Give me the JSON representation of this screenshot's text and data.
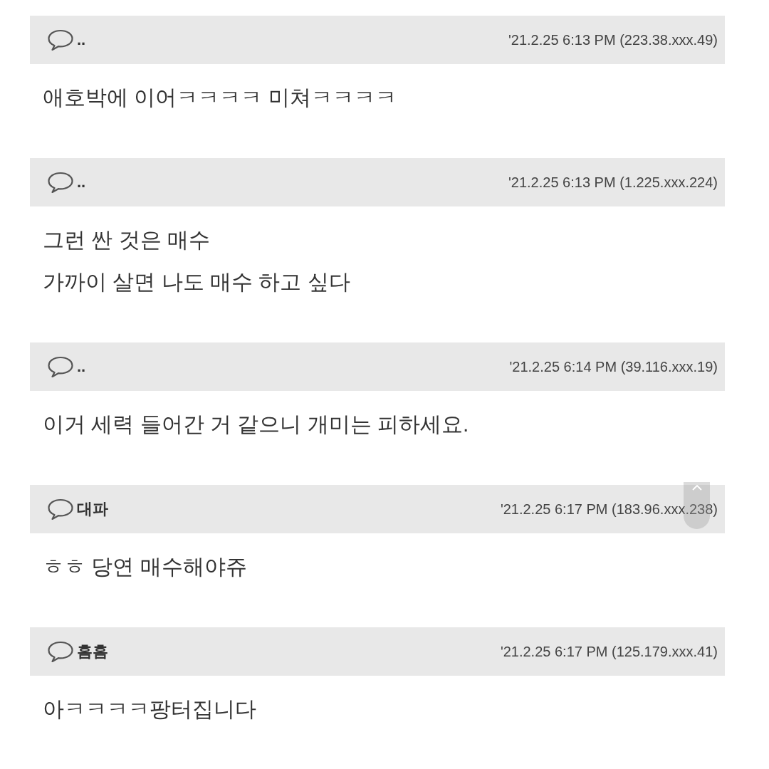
{
  "comments": [
    {
      "author": "..",
      "date": "'21.2.25 6:13 PM (223.38.xxx.49)",
      "lines": [
        "애호박에 이어ㅋㅋㅋㅋ 미쳐ㅋㅋㅋㅋ"
      ]
    },
    {
      "author": "..",
      "date": "'21.2.25 6:13 PM (1.225.xxx.224)",
      "lines": [
        "그런 싼 것은 매수",
        "가까이 살면 나도 매수 하고 싶다"
      ]
    },
    {
      "author": "..",
      "date": "'21.2.25 6:14 PM (39.116.xxx.19)",
      "lines": [
        "이거 세력 들어간 거 같으니 개미는 피하세요."
      ]
    },
    {
      "author": "대파",
      "date": "'21.2.25 6:17 PM (183.96.xxx.238)",
      "lines": [
        "ㅎㅎ 당연 매수해야쥬"
      ]
    },
    {
      "author": "흠흠",
      "date": "'21.2.25 6:17 PM (125.179.xxx.41)",
      "lines": [
        "아ㅋㅋㅋㅋ팡터집니다"
      ]
    }
  ]
}
